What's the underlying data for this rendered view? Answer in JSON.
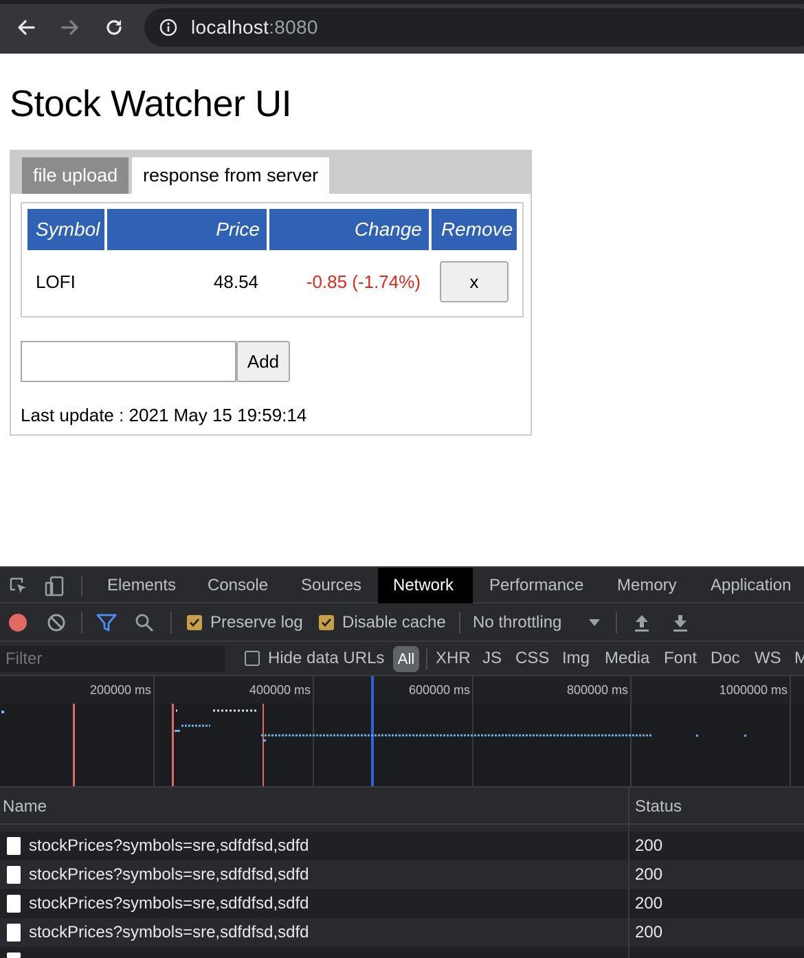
{
  "browser": {
    "url_host": "localhost",
    "url_port": ":8080",
    "back_icon": "arrow-left-icon",
    "forward_icon": "arrow-right-icon",
    "reload_icon": "reload-icon",
    "site_info_icon": "info-icon"
  },
  "page": {
    "title": "Stock Watcher UI",
    "tabs": [
      {
        "label": "file upload",
        "active": false
      },
      {
        "label": "response from server",
        "active": true
      }
    ],
    "table": {
      "headers": [
        "Symbol",
        "Price",
        "Change",
        "Remove"
      ],
      "rows": [
        {
          "symbol": "LOFI",
          "price": "48.54",
          "change": "-0.85 (-1.74%)",
          "remove_label": "x"
        }
      ]
    },
    "add_input_value": "",
    "add_button_label": "Add",
    "last_update": "Last update : 2021 May 15 19:59:14",
    "colors": {
      "header_bg": "#2f62b5",
      "negative_change": "#e02a1a"
    }
  },
  "devtools": {
    "tabs": [
      "Elements",
      "Console",
      "Sources",
      "Network",
      "Performance",
      "Memory",
      "Application"
    ],
    "active_tab": "Network",
    "toolbar": {
      "preserve_log": {
        "label": "Preserve log",
        "checked": true
      },
      "disable_cache": {
        "label": "Disable cache",
        "checked": true
      },
      "throttling": "No throttling"
    },
    "filter": {
      "placeholder": "Filter",
      "hide_data_urls": {
        "label": "Hide data URLs",
        "checked": false
      },
      "types": [
        "All",
        "XHR",
        "JS",
        "CSS",
        "Img",
        "Media",
        "Font",
        "Doc",
        "WS",
        "M"
      ]
    },
    "timeline": {
      "ticks": [
        "200000 ms",
        "400000 ms",
        "600000 ms",
        "800000 ms",
        "1000000 ms"
      ]
    },
    "table": {
      "columns": [
        "Name",
        "Status"
      ],
      "rows": [
        {
          "name": "stockPrices?symbols=sre,sdfdfsd,sdfd",
          "status": "200"
        },
        {
          "name": "stockPrices?symbols=sre,sdfdfsd,sdfd",
          "status": "200"
        },
        {
          "name": "stockPrices?symbols=sre,sdfdfsd,sdfd",
          "status": "200"
        },
        {
          "name": "stockPrices?symbols=sre,sdfdfsd,sdfd",
          "status": "200"
        }
      ]
    }
  }
}
